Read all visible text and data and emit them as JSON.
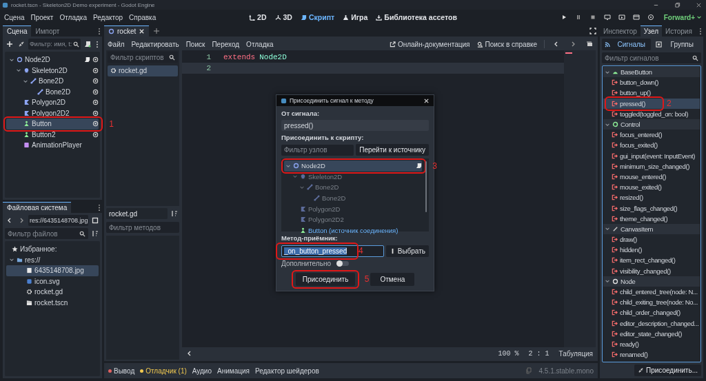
{
  "window": {
    "title": "rocket.tscn - Skeleton2D Demo experiment - Godot Engine"
  },
  "menu": [
    "Сцена",
    "Проект",
    "Отладка",
    "Редактор",
    "Справка"
  ],
  "workspaces": [
    {
      "label": "2D",
      "kind": "canvas",
      "selected": false
    },
    {
      "label": "3D",
      "kind": "spatial",
      "selected": false
    },
    {
      "label": "Скрипт",
      "kind": "script",
      "selected": true
    },
    {
      "label": "Игра",
      "kind": "game",
      "selected": false
    },
    {
      "label": "Библиотека ассетов",
      "kind": "assetlib",
      "selected": false
    }
  ],
  "renderer": "Forward+",
  "scene_dock": {
    "tabs": [
      {
        "label": "Сцена",
        "selected": true
      },
      {
        "label": "Импорт",
        "selected": false
      }
    ],
    "filter_placeholder": "Фильтр: имя, t:",
    "tree": [
      {
        "name": "Node2D",
        "kind": "node2d",
        "script": true,
        "eye": true,
        "selected": false,
        "children": [
          {
            "name": "Skeleton2D",
            "kind": "skeleton",
            "script": false,
            "eye": true,
            "selected": false,
            "children": [
              {
                "name": "Bone2D",
                "kind": "bone",
                "script": false,
                "eye": true,
                "selected": false,
                "children": [
                  {
                    "name": "Bone2D",
                    "kind": "bone",
                    "script": false,
                    "eye": true,
                    "selected": false
                  }
                ]
              }
            ]
          },
          {
            "name": "Polygon2D",
            "kind": "polygon",
            "script": false,
            "eye": true,
            "selected": false
          },
          {
            "name": "Polygon2D2",
            "kind": "polygon",
            "script": false,
            "eye": true,
            "selected": false
          },
          {
            "name": "Button",
            "kind": "button",
            "script": false,
            "eye": true,
            "selected": true,
            "annotation": "1"
          },
          {
            "name": "Button2",
            "kind": "button",
            "script": false,
            "eye": true,
            "selected": false
          },
          {
            "name": "AnimationPlayer",
            "kind": "animation",
            "script": false,
            "eye": false,
            "selected": false
          }
        ]
      }
    ]
  },
  "filesystem": {
    "title": "Файловая система",
    "path": "res://6435148708.jpg",
    "filter_placeholder": "Фильтр файлов",
    "favorites": "Избранное:",
    "tree": [
      {
        "name": "res://",
        "kind": "folder",
        "selected": false,
        "children": [
          {
            "name": "6435148708.jpg",
            "kind": "image",
            "selected": true
          },
          {
            "name": "icon.svg",
            "kind": "svg",
            "selected": false
          },
          {
            "name": "rocket.gd",
            "kind": "gear",
            "selected": false
          },
          {
            "name": "rocket.tscn",
            "kind": "clapper",
            "selected": false
          }
        ]
      }
    ]
  },
  "script_editor": {
    "tabs": [
      {
        "label": "rocket",
        "selected": true
      }
    ],
    "menu": [
      "Файл",
      "Редактировать",
      "Поиск",
      "Переход",
      "Отладка"
    ],
    "docs_link": "Онлайн-документация",
    "help_search": "Поиск в справке",
    "script_filter_placeholder": "Фильтр скриптов",
    "scripts": [
      {
        "name": "rocket.gd",
        "selected": true
      }
    ],
    "current_script": "rocket.gd",
    "method_filter_placeholder": "Фильтр методов",
    "lines": [
      {
        "number": "1",
        "current": false,
        "tokens": [
          {
            "text": "extends",
            "kind": "keyword"
          },
          {
            "text": "Node2D",
            "kind": "type"
          }
        ]
      },
      {
        "number": "2",
        "current": true
      }
    ],
    "zoom": "100 %",
    "position": "2 : 1",
    "indent": "Табуляция"
  },
  "bottom_panel": {
    "tabs": [
      {
        "label": "Вывод",
        "color": "#e06060",
        "highlighted": false
      },
      {
        "label": "Отладчик (1)",
        "color": "#f0c850",
        "highlighted": true
      },
      {
        "label": "Аудио",
        "highlighted": false
      },
      {
        "label": "Анимация",
        "highlighted": false
      },
      {
        "label": "Редактор шейдеров",
        "highlighted": false
      }
    ],
    "version": "4.5.1.stable.mono"
  },
  "node_dock": {
    "tabs": [
      {
        "label": "Инспектор",
        "selected": false
      },
      {
        "label": "Узел",
        "selected": true
      },
      {
        "label": "История",
        "selected": false
      }
    ],
    "subtabs": [
      {
        "label": "Сигналы",
        "kind": "signals",
        "selected": true
      },
      {
        "label": "Группы",
        "kind": "groups",
        "selected": false
      }
    ],
    "filter_placeholder": "Фильтр сигналов",
    "classes": [
      {
        "name": "BaseButton",
        "kind": "basebutton",
        "signals": [
          {
            "name": "button_down()",
            "selected": false
          },
          {
            "name": "button_up()",
            "selected": false
          },
          {
            "name": "pressed()",
            "selected": true,
            "annotation": "2"
          },
          {
            "name": "toggled(toggled_on: bool)",
            "selected": false
          }
        ]
      },
      {
        "name": "Control",
        "kind": "control",
        "signals": [
          {
            "name": "focus_entered()",
            "selected": false
          },
          {
            "name": "focus_exited()",
            "selected": false
          },
          {
            "name": "gui_input(event: InputEvent)",
            "selected": false
          },
          {
            "name": "minimum_size_changed()",
            "selected": false
          },
          {
            "name": "mouse_entered()",
            "selected": false
          },
          {
            "name": "mouse_exited()",
            "selected": false
          },
          {
            "name": "resized()",
            "selected": false
          },
          {
            "name": "size_flags_changed()",
            "selected": false
          },
          {
            "name": "theme_changed()",
            "selected": false
          }
        ]
      },
      {
        "name": "CanvasItem",
        "kind": "canvasitem",
        "signals": [
          {
            "name": "draw()",
            "selected": false
          },
          {
            "name": "hidden()",
            "selected": false
          },
          {
            "name": "item_rect_changed()",
            "selected": false
          },
          {
            "name": "visibility_changed()",
            "selected": false
          }
        ]
      },
      {
        "name": "Node",
        "kind": "node",
        "signals": [
          {
            "name": "child_entered_tree(node: N...",
            "selected": false
          },
          {
            "name": "child_exiting_tree(node: No...",
            "selected": false
          },
          {
            "name": "child_order_changed()",
            "selected": false
          },
          {
            "name": "editor_description_changed...",
            "selected": false
          },
          {
            "name": "editor_state_changed()",
            "selected": false
          },
          {
            "name": "ready()",
            "selected": false
          },
          {
            "name": "renamed()",
            "selected": false
          }
        ]
      }
    ],
    "connect_button": "Присоединить..."
  },
  "dialog": {
    "title": "Присоединить сигнал к методу",
    "from_label": "От сигнала:",
    "signal": "pressed()",
    "to_label": "Присоединить к скрипту:",
    "node_filter_placeholder": "Фильтр узлов",
    "goto_button": "Перейти к источнику",
    "tree": [
      {
        "name": "Node2D",
        "kind": "node2d",
        "script": true,
        "disabled": false,
        "source": false,
        "selected": true,
        "annotation": "3",
        "children": [
          {
            "name": "Skeleton2D",
            "kind": "skeleton",
            "script": false,
            "disabled": true,
            "source": false,
            "selected": false,
            "children": [
              {
                "name": "Bone2D",
                "kind": "bone",
                "script": false,
                "disabled": true,
                "source": false,
                "selected": false,
                "children": [
                  {
                    "name": "Bone2D",
                    "kind": "bone",
                    "script": false,
                    "disabled": true,
                    "source": false,
                    "selected": false
                  }
                ]
              }
            ]
          },
          {
            "name": "Polygon2D",
            "kind": "polygon",
            "script": false,
            "disabled": true,
            "source": false,
            "selected": false
          },
          {
            "name": "Polygon2D2",
            "kind": "polygon",
            "script": false,
            "disabled": true,
            "source": false,
            "selected": false
          },
          {
            "name": "Button (источник соединения)",
            "kind": "button",
            "script": false,
            "disabled": false,
            "source": true,
            "selected": false
          }
        ]
      }
    ],
    "method_label": "Метод-приёмник:",
    "method": "_on_button_pressed",
    "method_annotation": "4",
    "pick_button": "Выбрать",
    "advanced_label": "Дополнительно",
    "advanced_on": false,
    "buttons": [
      {
        "label": "Присоединить",
        "kind": "primary",
        "annotation": "5"
      },
      {
        "label": "Отмена",
        "kind": "secondary"
      }
    ]
  }
}
